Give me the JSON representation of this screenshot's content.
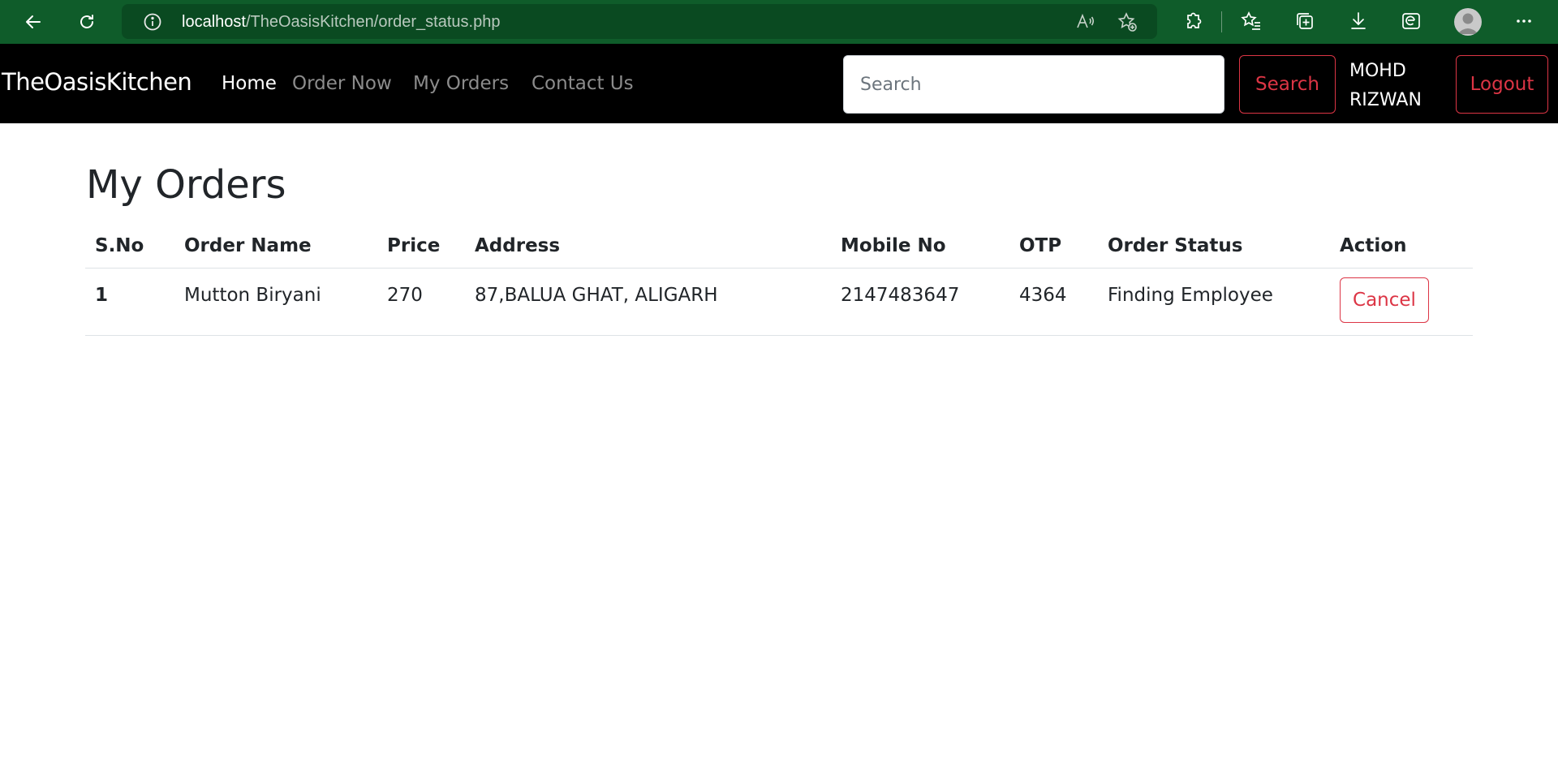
{
  "browser": {
    "url_host": "localhost",
    "url_path": "/TheOasisKitchen/order_status.php"
  },
  "navbar": {
    "brand": "TheOasisKitchen",
    "links": [
      {
        "label": "Home",
        "active": true
      },
      {
        "label": "Order Now",
        "active": false
      },
      {
        "label": "My Orders",
        "active": false
      },
      {
        "label": "Contact Us",
        "active": false
      }
    ],
    "search_placeholder": "Search",
    "search_button": "Search",
    "user_name": "MOHD RIZWAN",
    "logout_button": "Logout"
  },
  "main": {
    "title": "My Orders",
    "columns": [
      "S.No",
      "Order Name",
      "Price",
      "Address",
      "Mobile No",
      "OTP",
      "Order Status",
      "Action"
    ],
    "rows": [
      {
        "sno": "1",
        "order_name": "Mutton Biryani",
        "price": "270",
        "address": "87,BALUA GHAT, ALIGARH",
        "mobile": "2147483647",
        "otp": "4364",
        "status": "Finding Employee",
        "action": "Cancel"
      }
    ]
  },
  "colors": {
    "browser_bar": "#0f5c2a",
    "navbar": "#000000",
    "danger": "#dc3545"
  }
}
